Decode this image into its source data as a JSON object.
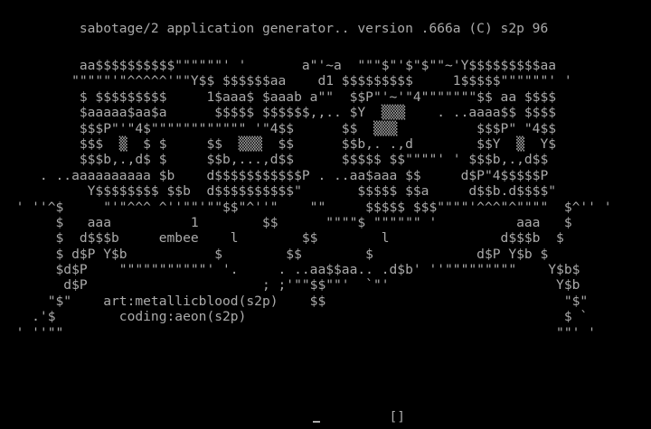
{
  "header": {
    "line": "          sabotage/2 application generator.. version .666a (C) s2p 96"
  },
  "art": {
    "lines": [
      "          aa$$$$$$$$$$\"\"\"\"\"\"' '       a\"'~a  \"\"\"$\"'$\"$\"\"~'Y$$$$$$$$$aa",
      "         \"\"\"\"\"'\"^^^^^'\"\"Y$$ $$$$$$aa    d1 $$$$$$$$$     1$$$$$\"\"\"\"\"\"' '",
      "          $ $$$$$$$$$     1$aaa$ $aaab a\"\"  $$P\"'~'\"4\"\"\"\"\"\"\"$$ aa $$$$",
      "          $aaaaa$aa$a      $$$$$ $$$$$$,,.. $Y  ▒▒▒    . ..aaaa$$ $$$$",
      "          $$$P\"'\"4$\"\"\"\"\"\"\"\"\"\"\"\" '\"4$$      $$  ▒▒▒          $$$P\" \"4$$",
      "          $$$  ▒  $ $     $$  ▒▒▒  $$      $$b,. .,d        $$Y  ▒  Y$",
      "          $$$b,.,d$ $     $$b,...,d$$      $$$$$ $$\"\"\"\"' ' $$$b,.,d$$",
      "     . ..aaaaaaaaaa $b    d$$$$$$$$$$$P . ..aa$aaa $$     d$P\"4$$$$$P",
      "           Y$$$$$$$$ $$b  d$$$$$$$$$$\"       $$$$$ $$a     d$$b.d$$$$\"",
      "  ' ''^$     \"'\"^^^ ^''\"\"'\"\"$$\"^''\"    \"\"     $$$$$ $$$\"\"\"\"'^^^\"^\"\"\"\"  $^'' '",
      "       $   aaa          1        $$      \"\"\"\"$ \"\"\"\"\"\" '          aaa   $",
      "       $  d$$$b     embee    l        $$        l              d$$$b  $",
      "       $ d$P Y$b           $        $$        $             d$P Y$b $",
      "       $d$P    \"\"\"\"\"\"\"\"\"\"\"' '.     . ..aa$$aa.. .d$b' ''\"\"\"\"\"\"\"\"\"    Y$b$",
      "        d$P                      ; ;'\"\"$$\"\"'  `\"'                     Y$b",
      "      \"$\"    art:metallicblood(s2p)    $$                              \"$\"",
      "    .'$        coding:aeon(s2p)                                        $ `",
      "  ' ''\"\"                                                              \"\"' '"
    ]
  },
  "prompt": {
    "text": "                                                 []"
  },
  "colors": {
    "background": "#000000",
    "foreground": "#aaaaaa"
  }
}
